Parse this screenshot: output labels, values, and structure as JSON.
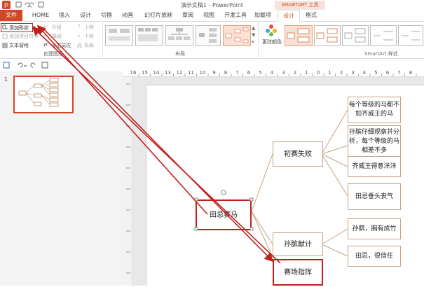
{
  "window": {
    "title": "演示文稿1 - PowerPoint",
    "tool_tab": "SMARTART 工具"
  },
  "tabs": [
    {
      "label": "文件"
    },
    {
      "label": "HOME"
    },
    {
      "label": "插入"
    },
    {
      "label": "设计"
    },
    {
      "label": "切换"
    },
    {
      "label": "动画"
    },
    {
      "label": "幻灯片放映"
    },
    {
      "label": "审阅"
    },
    {
      "label": "视图"
    },
    {
      "label": "开发工具"
    },
    {
      "label": "加载项"
    },
    {
      "label": "设计"
    },
    {
      "label": "格式"
    }
  ],
  "ribbon": {
    "add_shape": "添加形状",
    "add_bullet": "添加项目符号",
    "text_pane": "文本窗格",
    "promote": "升级",
    "demote": "降级",
    "right_to_left": "从右向左",
    "move_up": "上移",
    "move_down": "下移",
    "layout_btn": "布局",
    "group_create": "创建图形",
    "group_layouts": "布局",
    "change_colors": "更改颜色",
    "group_styles": "SmartArt 样式"
  },
  "slide_panel": {
    "slide_number": "1"
  },
  "ruler": {
    "labels": [
      "16",
      "15",
      "14",
      "13",
      "12",
      "11",
      "10",
      "9",
      "8",
      "7",
      "6",
      "5",
      "4",
      "3",
      "2",
      "1",
      "0",
      "1",
      "2",
      "3",
      "4",
      "5",
      "6",
      "7",
      "8"
    ]
  },
  "diagram": {
    "root": "田忌赛马",
    "branch1": "初赛失败",
    "branch2": "孙膑献计",
    "branch3": "赛场指挥",
    "leaf1": "每个等级的马都不如齐威王的马",
    "leaf2": "孙膑仔细观察并分析，每个等级的马相差不多",
    "leaf3": "齐威王得意洋洋",
    "leaf4": "田忌垂头丧气",
    "leaf5": "孙膑，胸有成竹",
    "leaf6": "田忌，很信任"
  },
  "colors": {
    "file_tab": "#d24726",
    "accent": "#c2531f",
    "annotation": "#c0201c"
  }
}
